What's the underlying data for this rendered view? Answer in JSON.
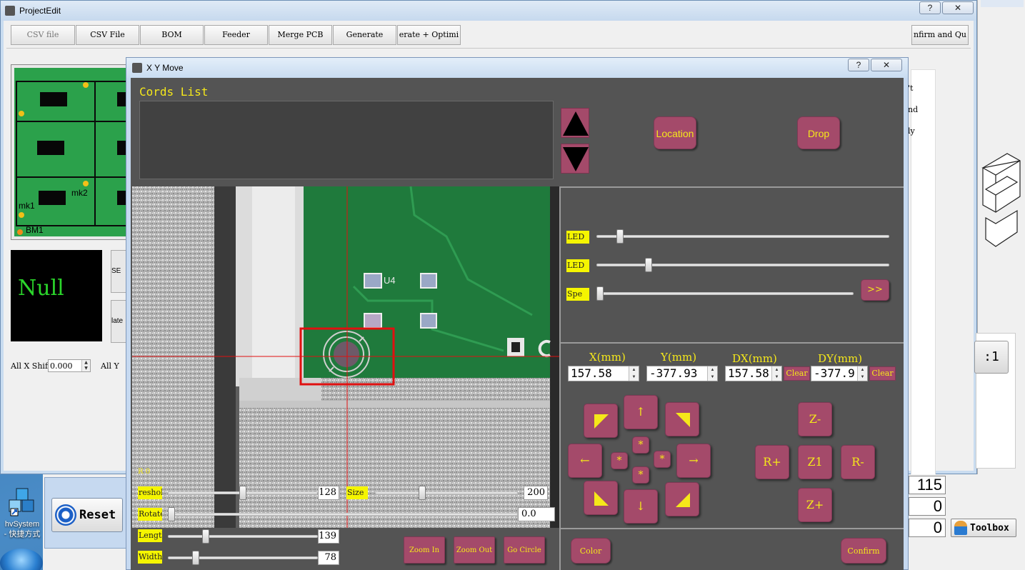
{
  "desktop": {
    "icon_label_line1": "hvSystem",
    "icon_label_line2": "- 快捷方式"
  },
  "project_window": {
    "title": "ProjectEdit",
    "help_btn": "?",
    "close_btn": "✕",
    "toolbar": [
      {
        "label": "CSV file",
        "dim": true
      },
      {
        "label": "CSV File"
      },
      {
        "label": "BOM"
      },
      {
        "label": "Feeder"
      },
      {
        "label": "Merge PCB"
      },
      {
        "label": "Generate"
      },
      {
        "label": "erate + Optimi"
      }
    ],
    "confirm_btn": "nfirm and Qu",
    "pcb": {
      "mk1": "mk1",
      "mk2": "mk2",
      "bm1": "BM1"
    },
    "null_text": "Null",
    "side_btn_1": "SE",
    "side_btn_2": "late",
    "shift": {
      "label_x": "All X Shif",
      "value_x": "0.000",
      "label_y": "All Y"
    },
    "right_text": [
      "'t",
      "nd",
      "ly"
    ],
    "num_fields": [
      "115",
      "0",
      "0"
    ],
    "btn_ratio": ":1",
    "reset_label": "Reset",
    "toolbox_label": "Toolbox"
  },
  "xy_window": {
    "title": "X Y Move",
    "help_btn": "?",
    "close_btn": "✕",
    "cords_title": "Cords List",
    "location_btn": "Location",
    "drop_btn": "Drop",
    "sliders": [
      {
        "label": "LED",
        "level": 0.07
      },
      {
        "label": "LED",
        "level": 0.17
      },
      {
        "label": "Spe",
        "level": 0.0
      }
    ],
    "more_btn": ">>",
    "coords": {
      "x_label": "X(mm)",
      "x_value": "157.58",
      "y_label": "Y(mm)",
      "y_value": "-377.93",
      "dx_label": "DX(mm)",
      "dx_value": "157.58",
      "dy_label": "DY(mm)",
      "dy_value": "-377.9",
      "clear": "Clear"
    },
    "pad": {
      "up": "↑",
      "down": "↓",
      "left": "←",
      "right": "→",
      "star": "*",
      "z_minus": "Z-",
      "z_plus": "Z+",
      "r_plus": "R+",
      "r_minus": "R-",
      "z1": "Z1"
    },
    "camera": {
      "r_label": "R 0",
      "u4_label": "U4",
      "threshold": {
        "label": "reshol",
        "value": "128",
        "level": 0.5
      },
      "size": {
        "label": "Size",
        "value": "200",
        "level": 0.32
      },
      "rotate": {
        "label": "Rotate",
        "value": "0.0",
        "level": 0.0
      },
      "length": {
        "label": "Length",
        "value": "139",
        "level": 0.24
      },
      "width": {
        "label": "Width",
        "value": "78",
        "level": 0.17
      }
    },
    "zoom_in": "Zoom In",
    "zoom_out": "Zoom Out",
    "go_circle": "Go Circle",
    "color_btn": "Color",
    "confirm_btn": "Confirm"
  }
}
